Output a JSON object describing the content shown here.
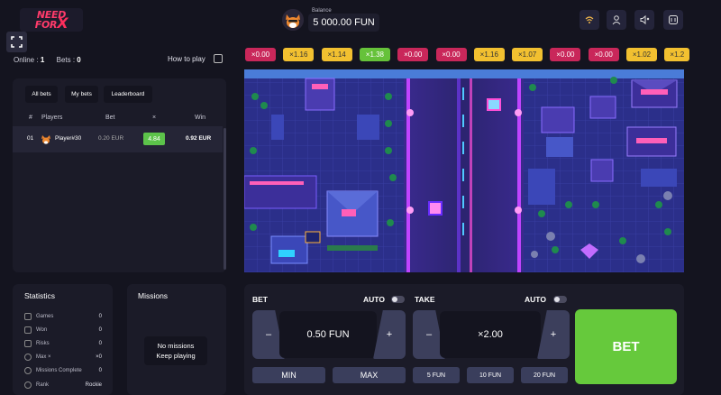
{
  "header": {
    "logo_line1": "NEED",
    "logo_line2": "FOR",
    "logo_x": "X",
    "balance_label": "Balance",
    "balance_value": "5 000.00 FUN",
    "icons": [
      "wifi-icon",
      "user-icon",
      "sound-icon",
      "settings-icon"
    ]
  },
  "status": {
    "online_label": "Online :",
    "online_count": "1",
    "bets_label": "Bets :",
    "bets_count": "0",
    "how_to_play": "How to play"
  },
  "bets_panel": {
    "tabs": [
      "All bets",
      "My bets",
      "Leaderboard"
    ],
    "columns": [
      "#",
      "Players",
      "Bet",
      "×",
      "Win"
    ],
    "rows": [
      {
        "num": "01",
        "player": "Player#30",
        "bet": "0.20 EUR",
        "mult": "4.84",
        "win": "0.92 EUR"
      }
    ]
  },
  "statistics": {
    "title": "Statistics",
    "rows": [
      {
        "icon": "gamepad-icon",
        "label": "Games",
        "value": "0"
      },
      {
        "icon": "trophy-icon",
        "label": "Won",
        "value": "0"
      },
      {
        "icon": "bolt-icon",
        "label": "Risks",
        "value": "0"
      },
      {
        "icon": "gauge-icon",
        "label": "Max ×",
        "value": "×0"
      },
      {
        "icon": "check-icon",
        "label": "Missions Complete",
        "value": "0"
      },
      {
        "icon": "rank-icon",
        "label": "Rank",
        "value": "Rockie"
      }
    ]
  },
  "missions": {
    "title": "Missions",
    "empty_line1": "No missions",
    "empty_line2": "Keep playing"
  },
  "history": [
    {
      "label": "×0.00",
      "color": "red"
    },
    {
      "label": "×1.16",
      "color": "yellow"
    },
    {
      "label": "×1.14",
      "color": "yellow"
    },
    {
      "label": "×1.38",
      "color": "green"
    },
    {
      "label": "×0.00",
      "color": "red"
    },
    {
      "label": "×0.00",
      "color": "red"
    },
    {
      "label": "×1.16",
      "color": "yellow"
    },
    {
      "label": "×1.07",
      "color": "yellow"
    },
    {
      "label": "×0.00",
      "color": "red"
    },
    {
      "label": "×0.00",
      "color": "red"
    },
    {
      "label": "×1.02",
      "color": "yellow"
    },
    {
      "label": "×1.2",
      "color": "yellow"
    }
  ],
  "controls": {
    "bet_label": "BET",
    "auto_label": "AUTO",
    "take_label": "TAKE",
    "bet_value": "0.50 FUN",
    "take_value": "×2.00",
    "minus": "–",
    "plus": "+",
    "min_label": "MIN",
    "max_label": "MAX",
    "quick_amounts": [
      "5 FUN",
      "10 FUN",
      "20 FUN"
    ],
    "bet_button": "BET"
  },
  "colors": {
    "accent_green": "#66c93c",
    "chip_red": "#c9275a",
    "chip_yellow": "#f2c030",
    "road_neon": "#c044ff",
    "city_blue": "#2b2f8a"
  }
}
